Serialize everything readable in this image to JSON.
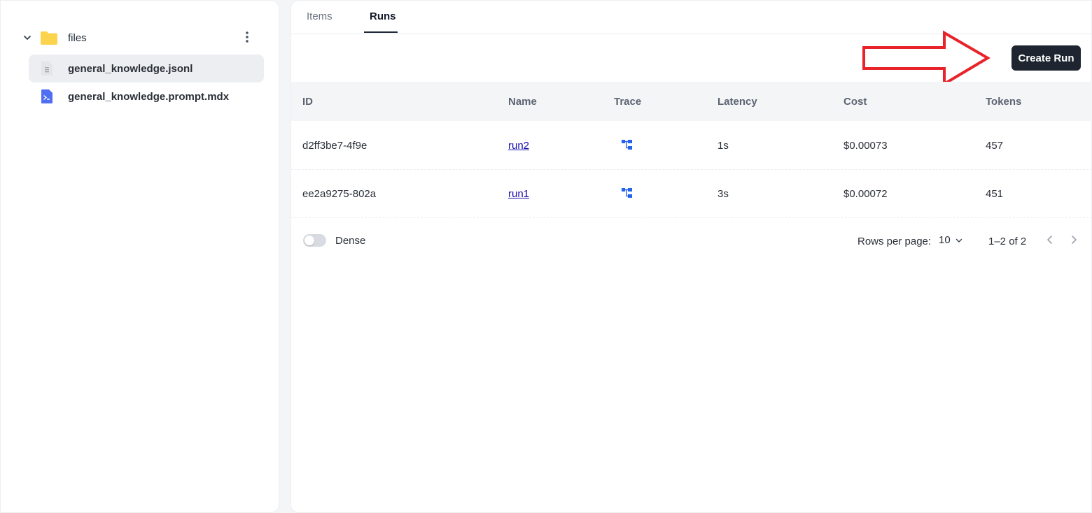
{
  "sidebar": {
    "folder": {
      "label": "files",
      "icon": "folder-icon",
      "color": "#fcd34d"
    },
    "files": [
      {
        "label": "general_knowledge.jsonl",
        "icon": "document-icon",
        "selected": true
      },
      {
        "label": "general_knowledge.prompt.mdx",
        "icon": "prompt-file-icon",
        "selected": false
      }
    ]
  },
  "tabs": [
    {
      "label": "Items",
      "active": false
    },
    {
      "label": "Runs",
      "active": true
    }
  ],
  "toolbar": {
    "create_run_label": "Create Run",
    "annotation_color": "#e8232a"
  },
  "table": {
    "headers": [
      "ID",
      "Name",
      "Trace",
      "Latency",
      "Cost",
      "Tokens"
    ],
    "rows": [
      {
        "id": "d2ff3be7-4f9e",
        "name": "run2",
        "latency": "1s",
        "cost": "$0.00073",
        "tokens": "457"
      },
      {
        "id": "ee2a9275-802a",
        "name": "run1",
        "latency": "3s",
        "cost": "$0.00072",
        "tokens": "451"
      }
    ]
  },
  "footer": {
    "dense_label": "Dense",
    "dense_enabled": false,
    "rows_per_page_label": "Rows per page:",
    "rows_per_page_value": "10",
    "page_info": "1–2 of 2"
  },
  "colors": {
    "accent": "#1e2530",
    "link": "#1a0dab",
    "trace_icon": "#2563eb",
    "prompt_icon": "#4f6ef2"
  }
}
